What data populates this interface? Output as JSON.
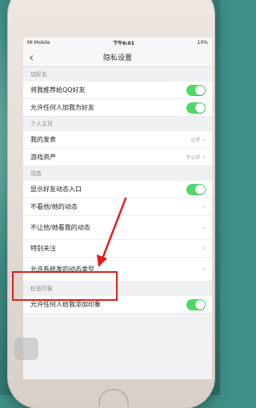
{
  "status": {
    "carrier": "Mi Mobile",
    "time": "下午6:01",
    "battery": "10%"
  },
  "nav": {
    "title": "隐私设置"
  },
  "sections": [
    {
      "label": "加好友",
      "rows": [
        {
          "label": "将我推荐给QQ好友",
          "toggle_on": true
        },
        {
          "label": "允许任何人加我为好友",
          "toggle_on": true
        }
      ]
    },
    {
      "label": "个人主页",
      "rows": [
        {
          "label": "我的发表",
          "value": "公开"
        },
        {
          "label": "游戏资产",
          "value": "不公开"
        }
      ]
    },
    {
      "label": "动态",
      "rows": [
        {
          "label": "显示好友动态入口",
          "toggle_on": true
        },
        {
          "label": "不看他/她的动态"
        },
        {
          "label": "不让他/她看我的动态"
        },
        {
          "label": "特别关注"
        },
        {
          "label": "允许系统发的动态类型"
        }
      ]
    },
    {
      "label": "标签印象",
      "rows": [
        {
          "label": "允许任何人给我添加印象",
          "toggle_on": true
        }
      ]
    }
  ],
  "annotation_color": "#e02020"
}
